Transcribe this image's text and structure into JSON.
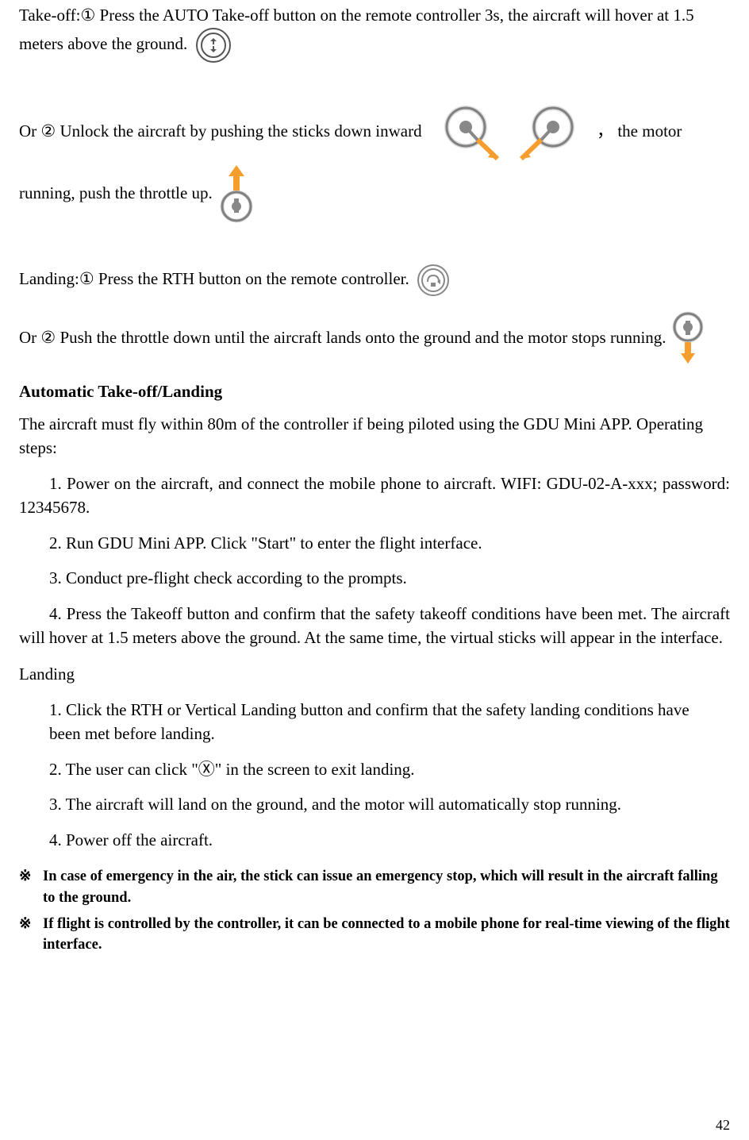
{
  "para1_a": "Take-off:",
  "para1_num": "①",
  "para1_b": " Press the AUTO Take-off button on the remote controller 3s, the aircraft will hover at 1.5 meters above the ground.",
  "para2_a": "Or ",
  "para2_num": "②",
  "para2_b": " Unlock the aircraft by pushing the sticks down inward ",
  "para2_c": "， the motor running, push the throttle up. ",
  "para3_a": "Landing:",
  "para3_num": "①",
  "para3_b": " Press the RTH button on the remote controller. ",
  "para4_a": "Or ",
  "para4_num": "②",
  "para4_b": " Push the throttle down until the aircraft lands onto the ground and the motor stops running. ",
  "h1": "Automatic Take-off/Landing",
  "intro": "The aircraft must fly within 80m of the controller if being piloted using the GDU Mini APP. Operating steps:",
  "steps": [
    "1.  Power on the aircraft, and connect the mobile phone to aircraft. WIFI: GDU-02-A-xxx; password: 12345678.",
    "2.  Run GDU Mini APP. Click \"Start\" to enter the flight interface.",
    "3.  Conduct pre-flight check according to the prompts.",
    "4.  Press the Takeoff button and confirm that the safety takeoff conditions have been met. The aircraft will hover at 1.5 meters above the ground. At the same time, the virtual sticks will appear in the interface."
  ],
  "landing_h": "Landing",
  "landing_steps": [
    "1. Click the RTH or Vertical Landing button and confirm that the safety landing conditions have been met before landing.",
    "2. The user can click \"Ⓧ\" in the screen to exit landing.",
    "3. The aircraft will land on the ground, and the motor will automatically stop running.",
    "4. Power off the aircraft."
  ],
  "note_sym": "※",
  "notes": [
    "In case of emergency in the air, the stick can issue an emergency stop, which will result in the aircraft falling to the ground.",
    "If flight is controlled by the controller, it can be connected to a mobile phone for real-time viewing of the flight interface."
  ],
  "page_number": "42",
  "icons": {
    "auto_takeoff": "auto-takeoff-icon",
    "sticks_inward": "sticks-inward-icon",
    "throttle_up": "throttle-up-icon",
    "rth": "rth-icon",
    "throttle_down": "throttle-down-icon"
  }
}
